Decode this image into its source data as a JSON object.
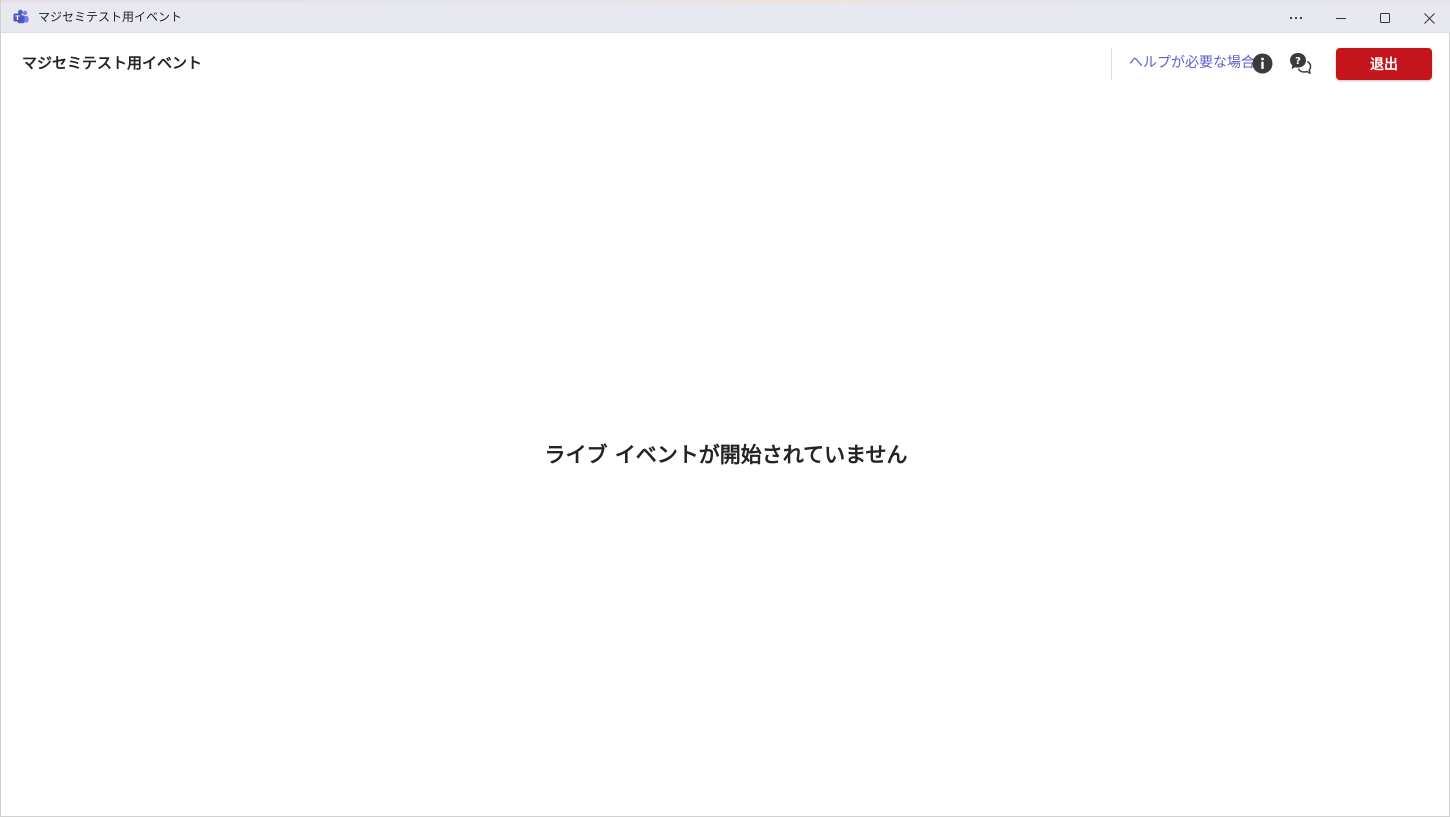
{
  "window": {
    "title": "マジセミテスト用イベント",
    "app_icon": "teams-icon",
    "controls": {
      "more": "more-options-icon",
      "minimize": "minimize-icon",
      "maximize": "maximize-icon",
      "close": "close-icon"
    }
  },
  "header": {
    "event_title": "マジセミテスト用イベント",
    "help_label": "ヘルプが必要な場合",
    "info_icon": "info-icon",
    "chat_help_icon": "chat-help-icon",
    "leave_label": "退出"
  },
  "main": {
    "status_message": "ライブ イベントが開始されていません"
  },
  "colors": {
    "accent": "#5b5fc7",
    "leave_button": "#c4141c",
    "text": "#242424",
    "titlebar": "#e8e8f0"
  }
}
